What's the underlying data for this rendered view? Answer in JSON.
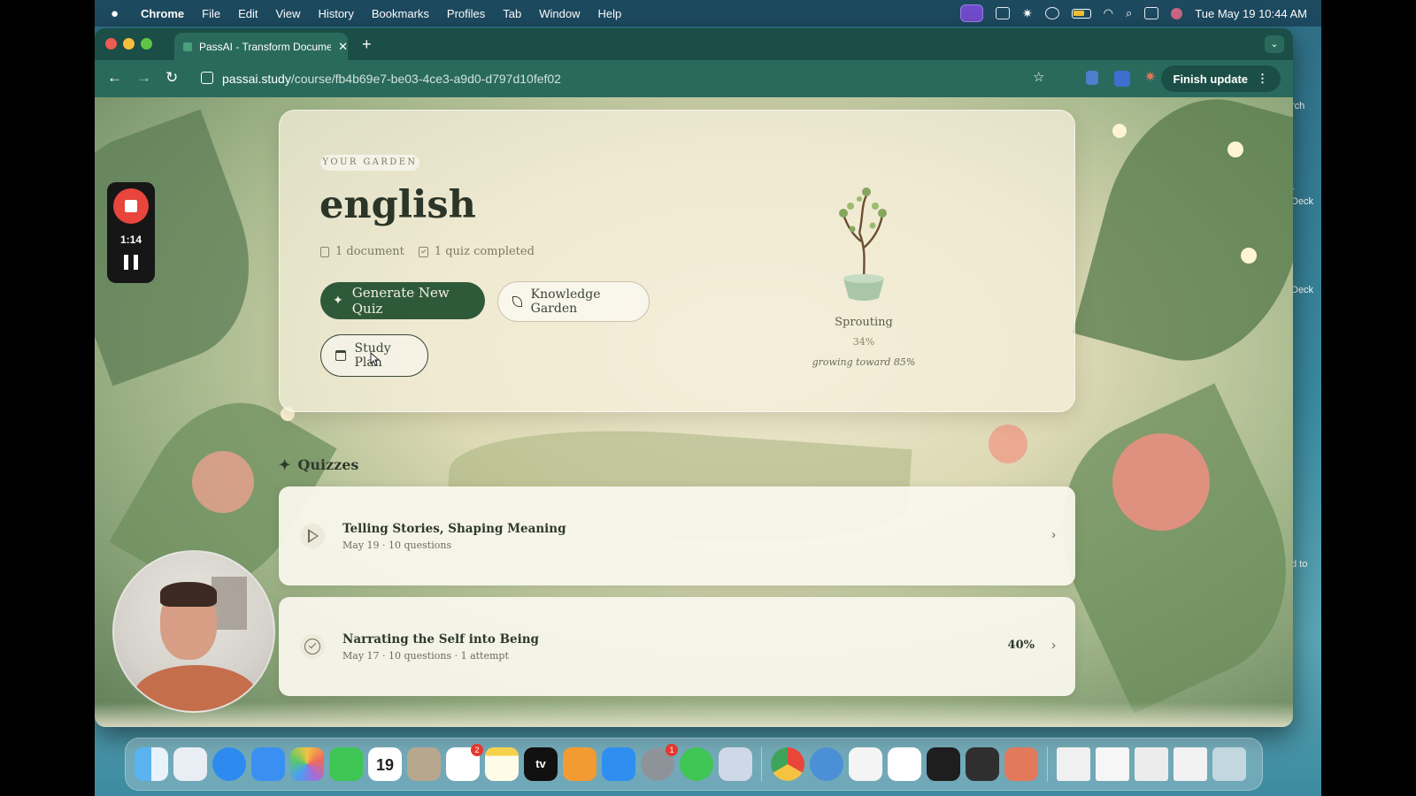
{
  "menubar": {
    "app": "Chrome",
    "menus": [
      "File",
      "Edit",
      "View",
      "History",
      "Bookmarks",
      "Profiles",
      "Tab",
      "Window",
      "Help"
    ],
    "datetime": "Tue May 19  10:44 AM"
  },
  "browser": {
    "tab_title": "PassAI - Transform Document",
    "url_host": "passai.study",
    "url_path": "/course/fb4b69e7-be03-4ce3-a9d0-d797d10fef02",
    "finish_update": "Finish update"
  },
  "recorder": {
    "elapsed": "1:14"
  },
  "hero": {
    "eyebrow": "YOUR GARDEN",
    "course_title": "english",
    "documents": "1 document",
    "quizzes_completed": "1 quiz completed",
    "generate_quiz": "Generate New Quiz",
    "knowledge_garden": "Knowledge Garden",
    "study_plan": "Study Plan",
    "growth_stage": "Sprouting",
    "growth_percent": "34%",
    "growth_target": "growing toward 85%"
  },
  "quizzes": {
    "header": "Quizzes",
    "items": [
      {
        "title": "Telling Stories, Shaping Meaning",
        "meta": "May 19 · 10 questions",
        "score": "",
        "status": "new"
      },
      {
        "title": "Narrating the Self into Being",
        "meta": "May 17 · 10 questions · 1 attempt",
        "score": "40%",
        "status": "completed"
      }
    ]
  },
  "dock": {
    "calendar_day": "19",
    "tv_label": "tv",
    "reminders_badge": "2",
    "settings_badge": "1"
  },
  "side_peek": [
    "rch",
    "r",
    "Deck",
    "Deck",
    "d to"
  ],
  "colors": {
    "primary_button": "#2f5a3a",
    "card_bg": "#faf8ee",
    "accent_record": "#e8453c"
  }
}
